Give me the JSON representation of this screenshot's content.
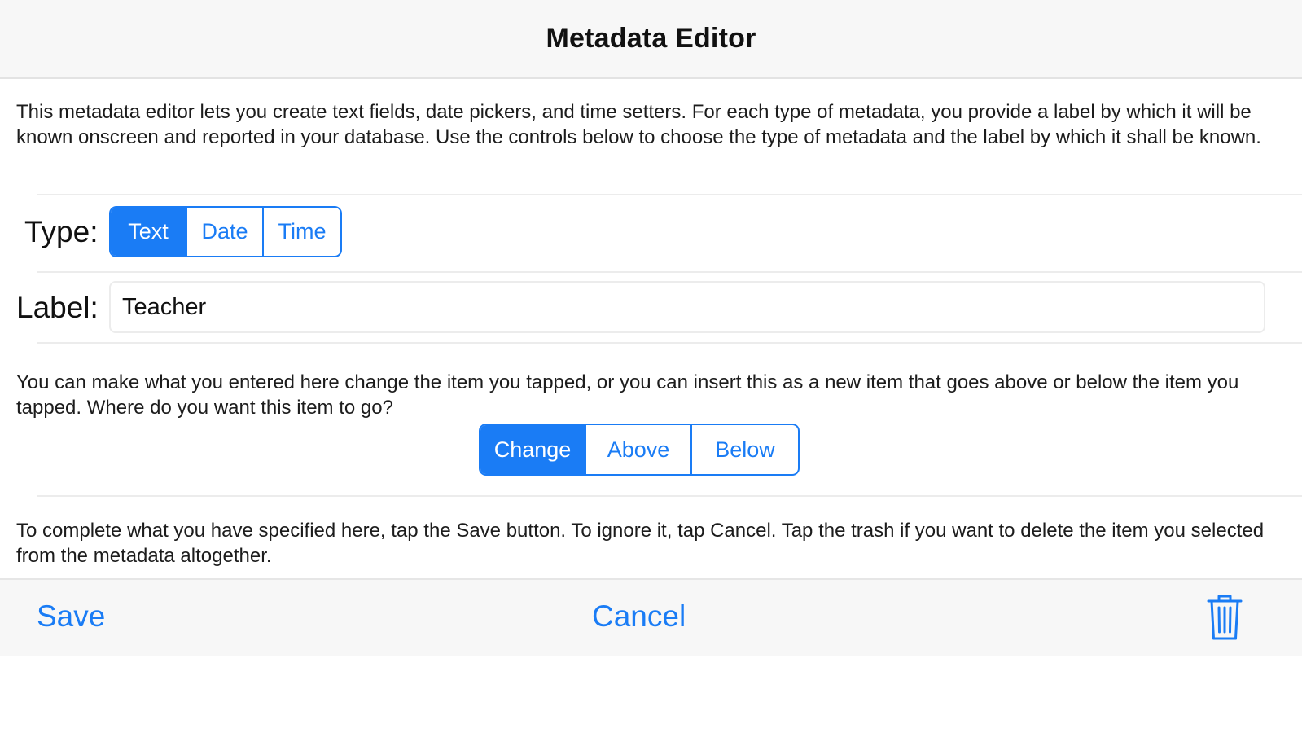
{
  "header": {
    "title": "Metadata Editor"
  },
  "intro_text": "This metadata editor lets you create text fields, date pickers, and time setters. For each type of metadata, you provide a label by which it will be known onscreen and reported in your database. Use the controls below to choose the type of metadata and the label by which it shall be known.",
  "type_row": {
    "label": "Type:",
    "options": [
      "Text",
      "Date",
      "Time"
    ],
    "selected": "Text"
  },
  "label_row": {
    "label": "Label:",
    "value": "Teacher"
  },
  "placement_text": "You can make what you entered here change the item you tapped, or you can insert this as a new item that goes above or below the item you tapped. Where do you want this item to go?",
  "placement": {
    "options": [
      "Change",
      "Above",
      "Below"
    ],
    "selected": "Change"
  },
  "completion_text": "To complete what you have specified here, tap the Save button. To ignore it, tap Cancel. Tap the trash if you want to delete the item you selected from the metadata altogether.",
  "toolbar": {
    "save_label": "Save",
    "cancel_label": "Cancel",
    "trash_icon": "trash-icon"
  },
  "colors": {
    "accent": "#1a7cf5",
    "bar_background": "#f7f7f7"
  }
}
